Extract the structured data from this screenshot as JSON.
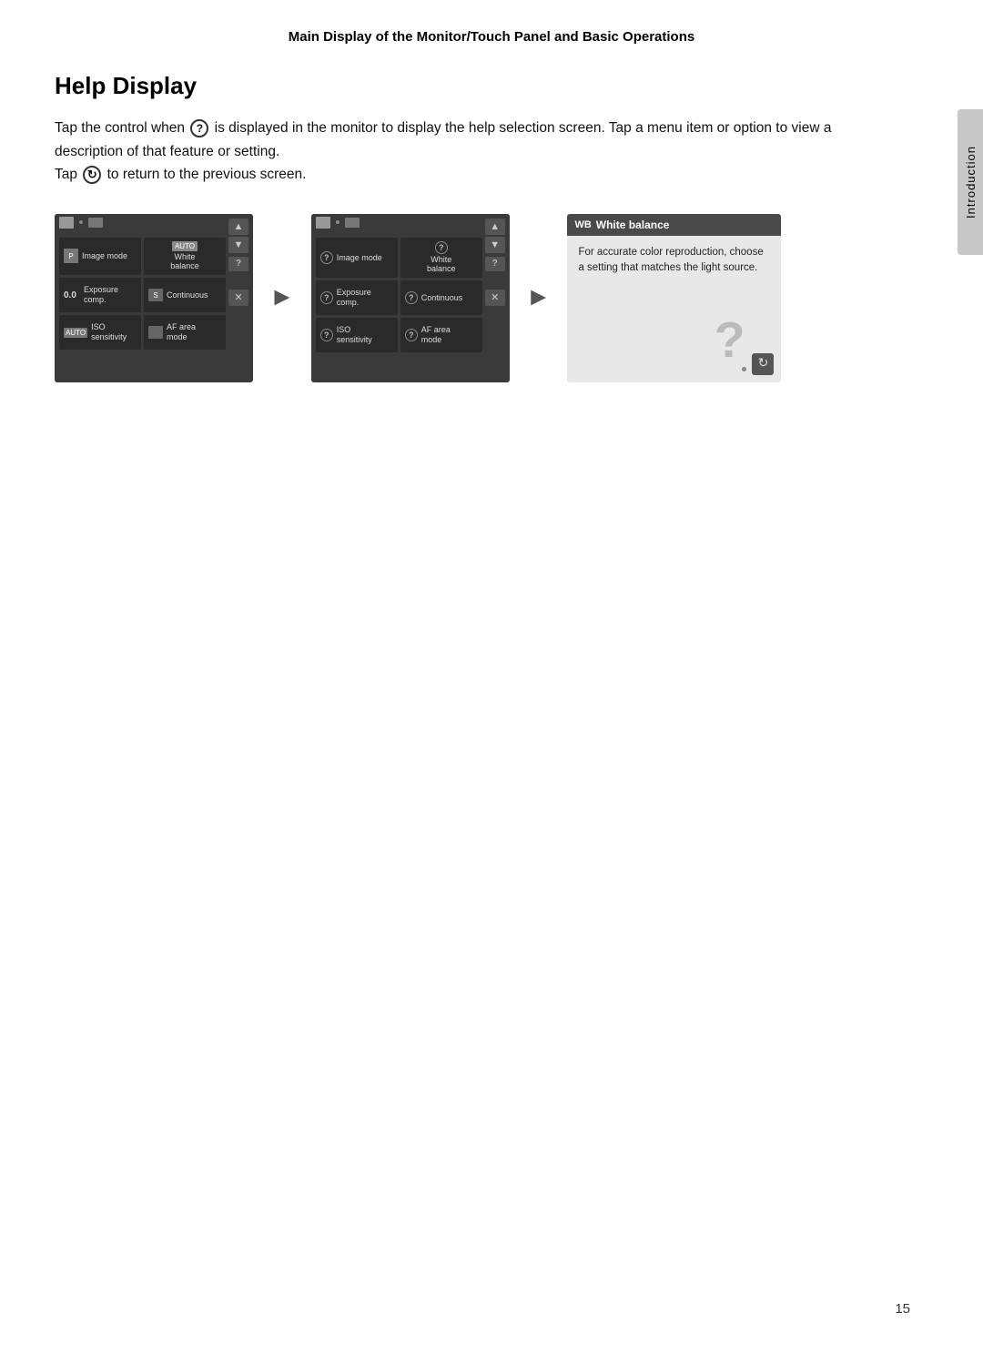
{
  "page": {
    "header": "Main Display of the Monitor/Touch Panel and Basic Operations",
    "page_number": "15",
    "sidebar_label": "Introduction"
  },
  "section": {
    "title": "Help Display",
    "description_part1": "Tap the control when",
    "description_part2": "is displayed in the monitor to display the help selection screen. Tap a menu item or option to view a description of that feature or setting.",
    "description_part3": "Tap",
    "description_part4": "to return to the previous screen."
  },
  "screen1": {
    "cells": [
      {
        "label": "Image mode",
        "badge": ""
      },
      {
        "label": "White\nbalance",
        "badge": "AUTO"
      },
      {
        "label": "Exposure\ncomp.",
        "badge": "0.0"
      },
      {
        "label": "Continuous",
        "badge": "S"
      },
      {
        "label": "ISO\nsensitivity",
        "badge": "AUTO"
      },
      {
        "label": "AF area\nmode",
        "badge": ""
      }
    ]
  },
  "screen2": {
    "cells": [
      {
        "label": "Image mode"
      },
      {
        "label": "White\nbalance"
      },
      {
        "label": "Exposure\ncomp."
      },
      {
        "label": "Continuous"
      },
      {
        "label": "ISO\nsensitivity"
      },
      {
        "label": "AF area\nmode"
      }
    ]
  },
  "help_screen": {
    "title": "White balance",
    "body": "For accurate color reproduction, choose a setting that matches the light source."
  }
}
